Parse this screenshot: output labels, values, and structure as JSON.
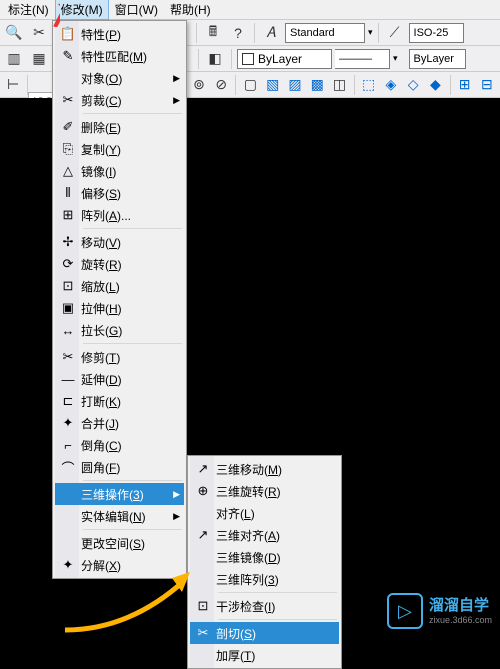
{
  "menubar": {
    "items": [
      "标注(N)",
      "修改(M)",
      "窗口(W)",
      "帮助(H)"
    ],
    "active_index": 1
  },
  "toolbar": {
    "standard_label": "Standard",
    "iso_label": "ISO-25",
    "bylayer1": "ByLayer",
    "bylayer2": "ByLayer",
    "iso_small": "ISO"
  },
  "menu1": [
    {
      "icon": "📋",
      "label": "特性(P)"
    },
    {
      "icon": "✎",
      "label": "特性匹配(M)"
    },
    {
      "icon": "",
      "label": "对象(O)",
      "sub": true
    },
    {
      "icon": "✂",
      "label": "剪裁(C)",
      "sub": true
    },
    {
      "sep": true
    },
    {
      "icon": "✐",
      "label": "删除(E)"
    },
    {
      "icon": "⎘",
      "label": "复制(Y)"
    },
    {
      "icon": "△",
      "label": "镜像(I)"
    },
    {
      "icon": "⫴",
      "label": "偏移(S)"
    },
    {
      "icon": "⊞",
      "label": "阵列(A)..."
    },
    {
      "sep": true
    },
    {
      "icon": "✢",
      "label": "移动(V)"
    },
    {
      "icon": "⟳",
      "label": "旋转(R)"
    },
    {
      "icon": "⊡",
      "label": "缩放(L)"
    },
    {
      "icon": "▣",
      "label": "拉伸(H)"
    },
    {
      "icon": "↔",
      "label": "拉长(G)"
    },
    {
      "sep": true
    },
    {
      "icon": "✂",
      "label": "修剪(T)"
    },
    {
      "icon": "―",
      "label": "延伸(D)"
    },
    {
      "icon": "⊏",
      "label": "打断(K)"
    },
    {
      "icon": "✦",
      "label": "合并(J)"
    },
    {
      "icon": "⌐",
      "label": "倒角(C)"
    },
    {
      "icon": "⌒",
      "label": "圆角(F)"
    },
    {
      "sep": true
    },
    {
      "icon": "",
      "label": "三维操作(3)",
      "sub": true,
      "hl": true
    },
    {
      "icon": "",
      "label": "实体编辑(N)",
      "sub": true
    },
    {
      "sep": true
    },
    {
      "icon": "",
      "label": "更改空间(S)"
    },
    {
      "icon": "✦",
      "label": "分解(X)"
    }
  ],
  "menu2": [
    {
      "icon": "↗",
      "label": "三维移动(M)"
    },
    {
      "icon": "⊕",
      "label": "三维旋转(R)"
    },
    {
      "icon": "",
      "label": "对齐(L)"
    },
    {
      "icon": "↗",
      "label": "三维对齐(A)"
    },
    {
      "icon": "",
      "label": "三维镜像(D)"
    },
    {
      "icon": "",
      "label": "三维阵列(3)"
    },
    {
      "sep": true
    },
    {
      "icon": "⊡",
      "label": "干涉检查(I)"
    },
    {
      "sep": true
    },
    {
      "icon": "✂",
      "label": "剖切(S)",
      "hl": true
    },
    {
      "icon": "",
      "label": "加厚(T)"
    }
  ],
  "watermark": {
    "cn": "溜溜自学",
    "py": "zixue.3d66.com"
  }
}
